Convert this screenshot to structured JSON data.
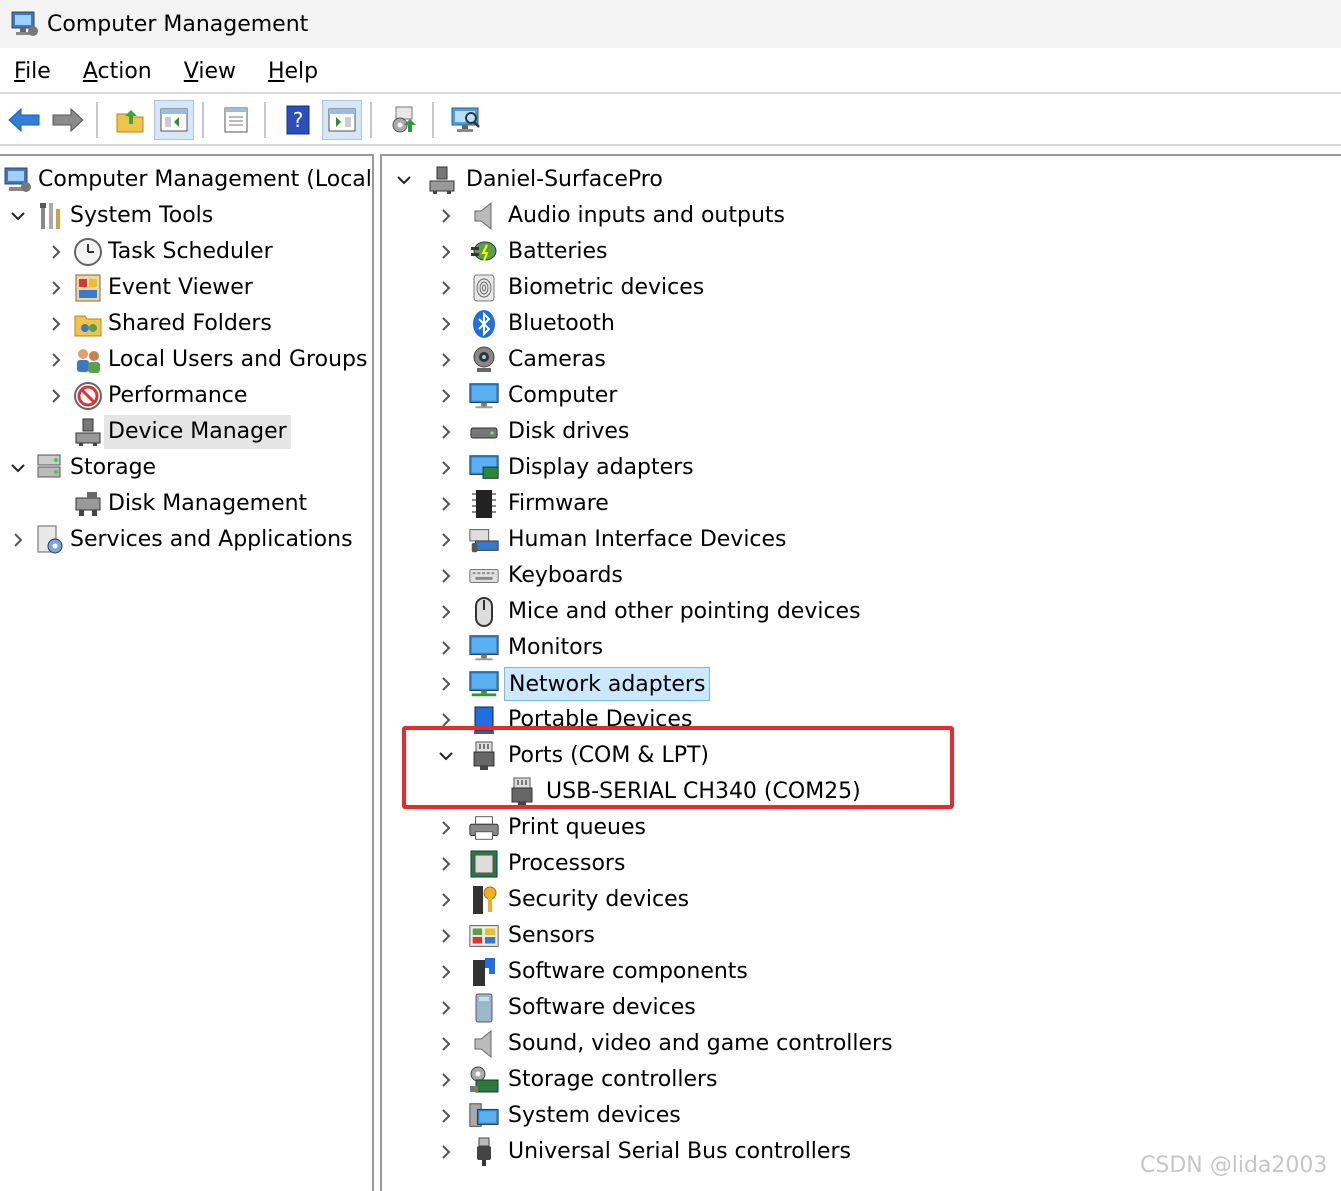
{
  "window": {
    "title": "Computer Management"
  },
  "menu": [
    {
      "key": "F",
      "rest": "ile"
    },
    {
      "key": "A",
      "rest": "ction"
    },
    {
      "key": "V",
      "rest": "iew"
    },
    {
      "key": "H",
      "rest": "elp"
    }
  ],
  "toolbar": [
    "back-icon",
    "forward-icon",
    "up-folder-icon",
    "show-hide-tree-icon",
    "properties-icon",
    "help-icon",
    "show-action-pane-icon",
    "action-settings-icon",
    "scan-hardware-icon"
  ],
  "left_tree": [
    {
      "label": "Computer Management (Local)",
      "icon": "computer-management-icon",
      "level": 0,
      "chevron": "none"
    },
    {
      "label": "System Tools",
      "icon": "system-tools-icon",
      "level": 1,
      "chevron": "down"
    },
    {
      "label": "Task Scheduler",
      "icon": "clock-icon",
      "level": 2,
      "chevron": "right"
    },
    {
      "label": "Event Viewer",
      "icon": "event-viewer-icon",
      "level": 2,
      "chevron": "right"
    },
    {
      "label": "Shared Folders",
      "icon": "shared-folders-icon",
      "level": 2,
      "chevron": "right"
    },
    {
      "label": "Local Users and Groups",
      "icon": "users-icon",
      "level": 2,
      "chevron": "right"
    },
    {
      "label": "Performance",
      "icon": "performance-icon",
      "level": 2,
      "chevron": "right"
    },
    {
      "label": "Device Manager",
      "icon": "device-manager-icon",
      "level": 2,
      "chevron": "none",
      "selected": true
    },
    {
      "label": "Storage",
      "icon": "storage-icon",
      "level": 1,
      "chevron": "down"
    },
    {
      "label": "Disk Management",
      "icon": "disk-management-icon",
      "level": 2,
      "chevron": "none"
    },
    {
      "label": "Services and Applications",
      "icon": "services-icon",
      "level": 1,
      "chevron": "right"
    }
  ],
  "device_tree": {
    "root": "Daniel-SurfacePro",
    "categories": [
      {
        "label": "Audio inputs and outputs",
        "icon": "speaker-icon"
      },
      {
        "label": "Batteries",
        "icon": "battery-icon"
      },
      {
        "label": "Biometric devices",
        "icon": "fingerprint-icon"
      },
      {
        "label": "Bluetooth",
        "icon": "bluetooth-icon"
      },
      {
        "label": "Cameras",
        "icon": "camera-icon"
      },
      {
        "label": "Computer",
        "icon": "monitor-icon"
      },
      {
        "label": "Disk drives",
        "icon": "disk-drive-icon"
      },
      {
        "label": "Display adapters",
        "icon": "display-adapter-icon"
      },
      {
        "label": "Firmware",
        "icon": "chip-icon"
      },
      {
        "label": "Human Interface Devices",
        "icon": "hid-icon"
      },
      {
        "label": "Keyboards",
        "icon": "keyboard-icon"
      },
      {
        "label": "Mice and other pointing devices",
        "icon": "mouse-icon"
      },
      {
        "label": "Monitors",
        "icon": "monitor-icon"
      },
      {
        "label": "Network adapters",
        "icon": "network-adapter-icon",
        "selected": true
      },
      {
        "label": "Portable Devices",
        "icon": "portable-device-icon"
      },
      {
        "label": "Ports (COM & LPT)",
        "icon": "port-icon",
        "expanded": true
      },
      {
        "label": "USB-SERIAL CH340 (COM25)",
        "icon": "port-icon",
        "child": true
      },
      {
        "label": "Print queues",
        "icon": "printer-icon"
      },
      {
        "label": "Processors",
        "icon": "processor-icon"
      },
      {
        "label": "Security devices",
        "icon": "security-key-icon"
      },
      {
        "label": "Sensors",
        "icon": "sensor-icon"
      },
      {
        "label": "Software components",
        "icon": "software-component-icon"
      },
      {
        "label": "Software devices",
        "icon": "software-device-icon"
      },
      {
        "label": "Sound, video and game controllers",
        "icon": "speaker-icon"
      },
      {
        "label": "Storage controllers",
        "icon": "storage-controller-icon"
      },
      {
        "label": "System devices",
        "icon": "system-devices-icon"
      },
      {
        "label": "Universal Serial Bus controllers",
        "icon": "usb-icon"
      }
    ]
  },
  "watermark": "CSDN @lida2003",
  "colors": {
    "highlight_box": "#e52b2b",
    "selected_blue": "#cce8ff",
    "selected_grey": "#e5e5e5"
  }
}
